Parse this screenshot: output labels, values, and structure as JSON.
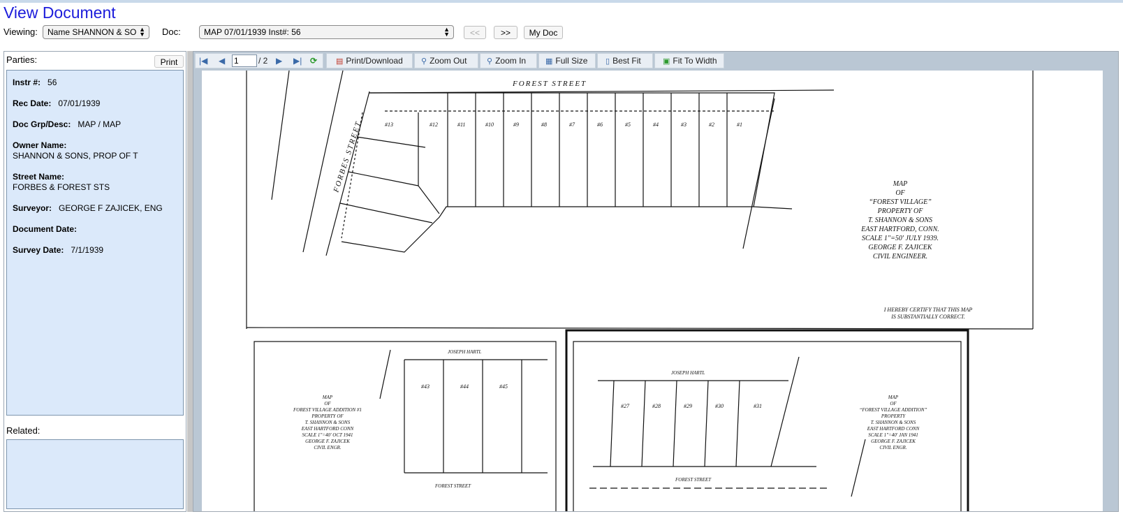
{
  "header": {
    "title": "View Document",
    "viewing_label": "Viewing:",
    "viewing_value": "Name SHANNON & SO",
    "doc_label": "Doc:",
    "doc_value": "MAP 07/01/1939 Inst#: 56",
    "prev_label": "<<",
    "next_label": ">>",
    "mydoc_label": "My Doc"
  },
  "left_panel": {
    "parties_label": "Parties:",
    "print_label": "Print",
    "related_label": "Related:",
    "fields": [
      {
        "label": "Instr #:",
        "value": "56",
        "inline": true
      },
      {
        "label": "Rec Date:",
        "value": "07/01/1939",
        "inline": true
      },
      {
        "label": "Doc Grp/Desc:",
        "value": "MAP / MAP",
        "inline": true
      },
      {
        "label": "Owner Name:",
        "value": "SHANNON & SONS, PROP OF T",
        "inline": false
      },
      {
        "label": "Street Name:",
        "value": "FORBES & FOREST STS",
        "inline": false
      },
      {
        "label": "Surveyor:",
        "value": "GEORGE F ZAJICEK, ENG",
        "inline": true
      },
      {
        "label": "Document Date:",
        "value": "",
        "inline": true
      },
      {
        "label": "Survey Date:",
        "value": "7/1/1939",
        "inline": true
      }
    ]
  },
  "viewer": {
    "page_current": "1",
    "page_total": "/ 2",
    "tools": {
      "print_download": "Print/Download",
      "zoom_out": "Zoom Out",
      "zoom_in": "Zoom In",
      "full_size": "Full Size",
      "best_fit": "Best Fit",
      "fit_to_width": "Fit To Width"
    },
    "map": {
      "street_top": "FOREST STREET",
      "street_left": "FORBES STREET",
      "title_lines": [
        "MAP",
        "OF",
        "“FOREST VILLAGE”",
        "PROPERTY OF",
        "T. SHANNON & SONS",
        "EAST HARTFORD, CONN.",
        "SCALE 1\"=50'   JULY 1939.",
        "GEORGE F. ZAJICEK",
        "CIVIL ENGINEER."
      ],
      "certify": [
        "I HEREBY CERTIFY THAT THIS MAP",
        "IS SUBSTANTIALLY CORRECT."
      ],
      "lot_numbers": [
        "#13",
        "#12",
        "#11",
        "#10",
        "#9",
        "#8",
        "#7",
        "#6",
        "#5",
        "#4",
        "#3",
        "#2",
        "#1"
      ],
      "inset1_title": [
        "MAP",
        "OF",
        "FOREST VILLAGE ADDITION #1",
        "PROPERTY OF",
        "T. SHANNON & SONS",
        "EAST HARTFORD   CONN",
        "SCALE 1\"=40'   OCT 1941",
        "GEORGE F. ZAJICEK",
        "CIVIL ENGR."
      ],
      "inset1_top": "JOSEPH HARTL",
      "inset1_bottom": "FOREST STREET",
      "inset1_lots": [
        "#43",
        "#44",
        "#45"
      ],
      "inset2_title": [
        "MAP",
        "OF",
        "“FOREST VILLAGE ADDITION”",
        "PROPERTY",
        "T. SHANNON & SONS",
        "EAST HARTFORD   CONN",
        "SCALE 1\"=40'   JAN 1941",
        "GEORGE F. ZAJICEK",
        "CIVIL ENGR."
      ],
      "inset2_top": "JOSEPH HARTL",
      "inset2_bottom": "FOREST STREET",
      "inset2_lots": [
        "#27",
        "#28",
        "#29",
        "#30",
        "#31"
      ]
    }
  }
}
